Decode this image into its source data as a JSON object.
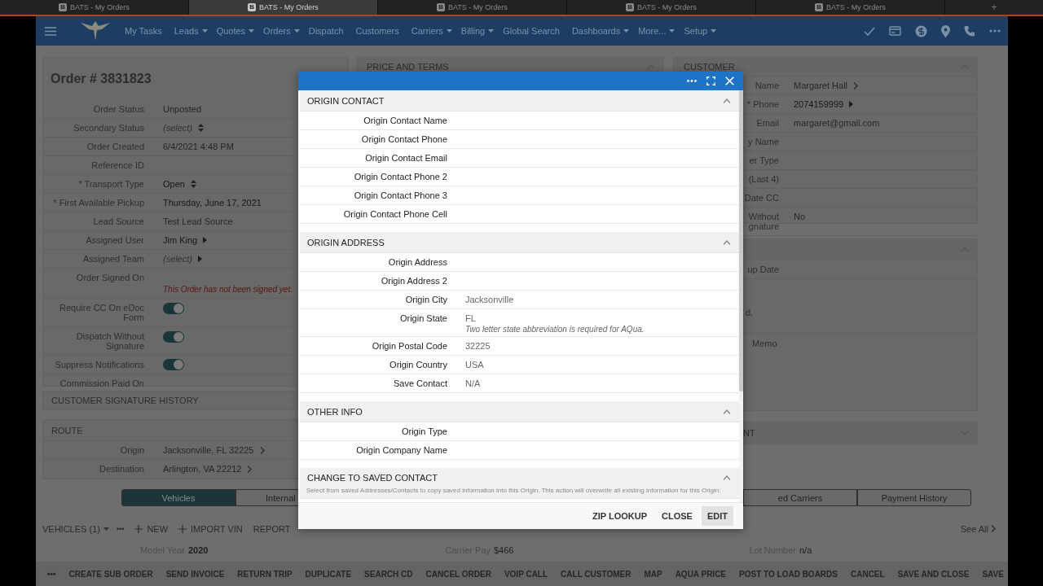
{
  "browser_tabs": [
    {
      "badge": "B",
      "title": "BATS - My Orders",
      "selected": false
    },
    {
      "badge": "B",
      "title": "BATS - My Orders",
      "selected": true
    },
    {
      "badge": "B",
      "title": "BATS - My Orders",
      "selected": false
    },
    {
      "badge": "B",
      "title": "BATS - My Orders",
      "selected": false
    },
    {
      "badge": "B",
      "title": "BATS - My Orders",
      "selected": false
    }
  ],
  "new_tab": "+",
  "nav": {
    "items": [
      {
        "label": "My Tasks",
        "dropdown": false
      },
      {
        "label": "Leads",
        "dropdown": true
      },
      {
        "label": "Quotes",
        "dropdown": true
      },
      {
        "label": "Orders",
        "dropdown": true
      },
      {
        "label": "Dispatch",
        "dropdown": false
      },
      {
        "label": "Customers",
        "dropdown": false
      },
      {
        "label": "Carriers",
        "dropdown": true
      },
      {
        "label": "Billing",
        "dropdown": true
      },
      {
        "label": "Global Search",
        "dropdown": false
      },
      {
        "label": "Dashboards",
        "dropdown": true
      },
      {
        "label": "More...",
        "dropdown": true
      },
      {
        "label": "Setup",
        "dropdown": true
      }
    ]
  },
  "order": {
    "title": "Order # 3831823",
    "fields": [
      {
        "label": "Order Status",
        "kind": "text",
        "value": "Unposted"
      },
      {
        "label": "Secondary Status",
        "kind": "select",
        "value": "(select)",
        "unset": true
      },
      {
        "label": "Order Created",
        "kind": "text",
        "value": "6/4/2021 4:48 PM"
      },
      {
        "label": "Reference ID"
      },
      {
        "label": "* Transport Type",
        "kind": "select",
        "value": "Open",
        "unset": false
      },
      {
        "label": "* First Available Pickup",
        "kind": "strong",
        "value": "Thursday, June 17, 2021"
      },
      {
        "label": "Lead Source",
        "kind": "text",
        "value": "Test Lead Source"
      },
      {
        "label": "Assigned User",
        "kind": "menu",
        "value": "Jim King",
        "unset": false
      },
      {
        "label": "Assigned Team",
        "kind": "menu",
        "value": "(select)",
        "unset": true
      },
      {
        "label": "Order Signed On",
        "kind": "note",
        "note": "This Order has not been signed yet."
      },
      {
        "label": "Require CC On eDoc\nForm",
        "kind": "toggle",
        "on": true
      },
      {
        "label": "Dispatch Without\nSignature",
        "kind": "toggle",
        "on": true
      },
      {
        "label": "Suppress Notifications",
        "kind": "toggle",
        "on": true
      },
      {
        "label": "Commission Paid On"
      }
    ]
  },
  "signature_history": {
    "title": "CUSTOMER SIGNATURE HISTORY"
  },
  "route": {
    "title": "ROUTE",
    "fields": [
      {
        "label": "Origin",
        "kind": "link",
        "value": "Jacksonville, FL 32225"
      },
      {
        "label": "Destination",
        "kind": "link",
        "value": "Arlington, VA 22212"
      }
    ]
  },
  "price_and_terms": {
    "title": "PRICE AND TERMS",
    "expanded": true
  },
  "customer": {
    "title": "CUSTOMER",
    "expanded": true,
    "fields": [
      {
        "label": "Name",
        "kind": "link",
        "value": "Margaret Hall"
      },
      {
        "label": "* Phone",
        "kind": "menu",
        "value": "2074159999",
        "unset": false
      },
      {
        "label": "Email",
        "kind": "text",
        "value": "margaret@gmail.com"
      },
      {
        "label": "y Name"
      },
      {
        "label": "er Type"
      },
      {
        "label": "(Last 4)"
      },
      {
        "label": "Date CC"
      },
      {
        "label": "Without\ngnature",
        "kind": "text",
        "value": "No"
      }
    ]
  },
  "pickup_panel": {
    "expanded": true,
    "fields": [
      {
        "label": "up Date"
      }
    ],
    "note": "d.",
    "memo_label": "Memo"
  },
  "collapsed_panel": {
    "title": "NT",
    "expanded": false
  },
  "bottom_tabs": [
    {
      "label": "Vehicles",
      "selected": true
    },
    {
      "label": "Internal",
      "selected": false
    },
    {
      "label": "ed Carriers",
      "selected": false
    },
    {
      "label": "Payment History",
      "selected": false
    }
  ],
  "vehicles": {
    "title": "VEHICLES (1)",
    "more": "•••",
    "actions": [
      {
        "label": "NEW",
        "kind": "add"
      },
      {
        "label": "IMPORT VIN",
        "kind": "add"
      },
      {
        "label": "REPORT",
        "kind": "plain"
      }
    ],
    "see_all": "See All",
    "details": [
      {
        "label": "Model Year",
        "value": "2020"
      },
      {
        "label": "Carrier Pay",
        "value": "$466"
      },
      {
        "label": "Lot Number",
        "value": "n/a"
      }
    ]
  },
  "action_bar": {
    "more": "•••",
    "buttons": [
      "CREATE SUB ORDER",
      "SEND INVOICE",
      "RETURN TRIP",
      "DUPLICATE",
      "SEARCH CD",
      "CANCEL ORDER",
      "VOIP CALL",
      "CALL CUSTOMER",
      "MAP",
      "AQUA PRICE",
      "POST TO LOAD BOARDS",
      "CANCEL",
      "SAVE AND CLOSE",
      "SAVE"
    ]
  },
  "modal": {
    "sections": [
      {
        "title": "ORIGIN CONTACT",
        "expanded": true,
        "rows": [
          {
            "label": "Origin Contact Name"
          },
          {
            "label": "Origin Contact Phone"
          },
          {
            "label": "Origin Contact Email"
          },
          {
            "label": "Origin Contact Phone 2"
          },
          {
            "label": "Origin Contact Phone 3"
          },
          {
            "label": "Origin Contact Phone Cell"
          }
        ]
      },
      {
        "title": "ORIGIN ADDRESS",
        "expanded": true,
        "rows": [
          {
            "label": "Origin Address"
          },
          {
            "label": "Origin Address 2"
          },
          {
            "label": "Origin City",
            "value": "Jacksonville"
          },
          {
            "label": "Origin State",
            "value": "FL",
            "hint": "Two letter state abbreviation is required for AQua."
          },
          {
            "label": "Origin Postal Code",
            "value": "32225"
          },
          {
            "label": "Origin Country",
            "value": "USA"
          },
          {
            "label": "Save Contact",
            "value": "N/A"
          }
        ]
      },
      {
        "title": "OTHER INFO",
        "expanded": true,
        "rows": [
          {
            "label": "Origin Type"
          },
          {
            "label": "Origin Company Name"
          }
        ]
      },
      {
        "title": "CHANGE TO SAVED CONTACT",
        "expanded": true,
        "description": "Select from saved Addresses/Contacts to copy saved information into this Origin. This action will overwrite all existing information for this Origin."
      }
    ],
    "buttons": [
      {
        "label": "ZIP LOOKUP",
        "highlighted": false
      },
      {
        "label": "CLOSE",
        "highlighted": false
      },
      {
        "label": "EDIT",
        "highlighted": true
      }
    ]
  }
}
